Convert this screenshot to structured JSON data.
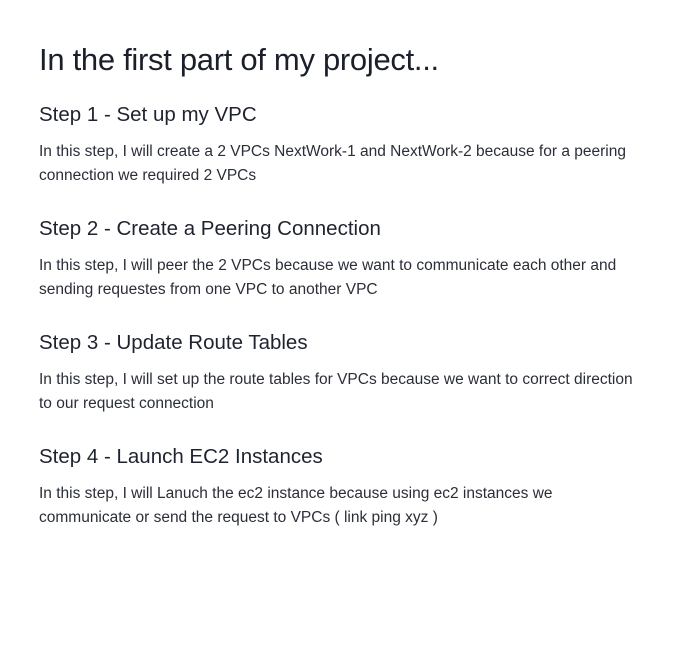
{
  "document": {
    "title": "In the first part of my project...",
    "steps": [
      {
        "heading": "Step 1 - Set up my VPC",
        "text": "In this step, I will create a 2 VPCs NextWork-1 and NextWork-2 because for a peering connection we required 2 VPCs"
      },
      {
        "heading": "Step 2 - Create a Peering Connection",
        "text": "In this step, I will peer the 2 VPCs because we want to communicate each other and sending requestes from one VPC to another VPC"
      },
      {
        "heading": "Step 3 - Update Route Tables",
        "text": "In this step, I will set up the route tables for VPCs because we want to correct direction to our request connection"
      },
      {
        "heading": "Step 4 - Launch EC2 Instances",
        "text": "In this step, I will Lanuch the ec2 instance because using ec2 instances we communicate or send the request to VPCs ( link ping xyz )"
      }
    ]
  }
}
